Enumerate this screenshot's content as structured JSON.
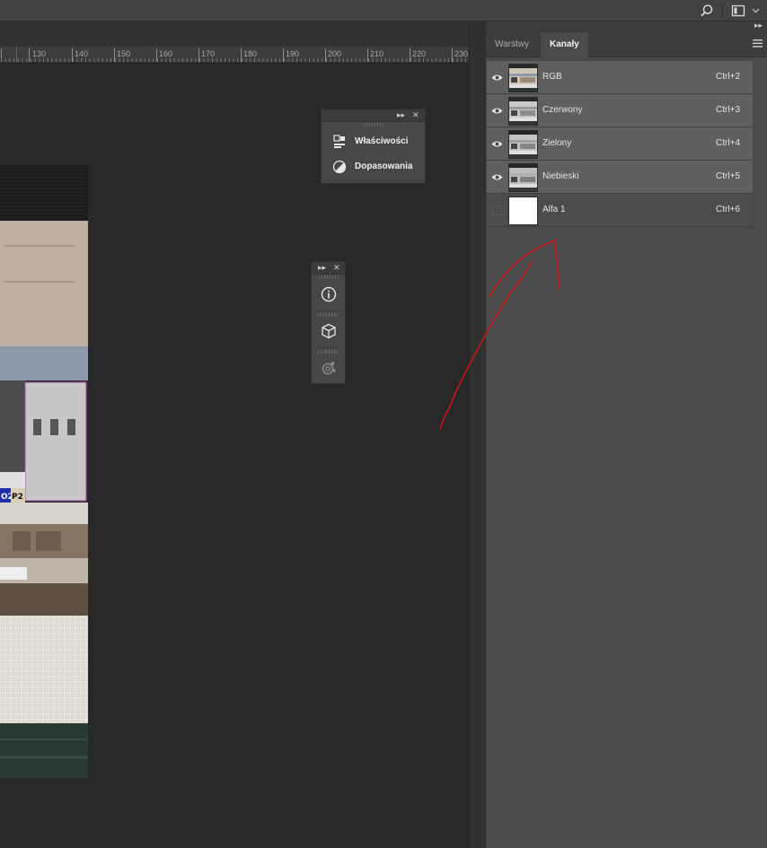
{
  "topbar": {
    "search_icon": "search-icon",
    "workspace_icon": "workspace-icon",
    "workspace_chevron": "chevron-down-icon"
  },
  "ruler": {
    "labels": [
      "130",
      "140",
      "150",
      "160",
      "170",
      "180",
      "190",
      "200",
      "210",
      "220",
      "230"
    ]
  },
  "float_panel_1": {
    "items": [
      {
        "label": "Właściwości",
        "icon": "properties-icon"
      },
      {
        "label": "Dopasowania",
        "icon": "adjustments-icon"
      }
    ]
  },
  "float_panel_2": {
    "items": [
      {
        "icon": "info-icon"
      },
      {
        "icon": "3d-cube-icon"
      },
      {
        "icon": "3d-scene-icon"
      }
    ]
  },
  "panel": {
    "tabs": [
      {
        "label": "Warstwy",
        "active": false
      },
      {
        "label": "Kanały",
        "active": true
      }
    ],
    "channels": [
      {
        "name": "RGB",
        "shortcut": "Ctrl+2",
        "visible": true,
        "selected": true
      },
      {
        "name": "Czerwony",
        "shortcut": "Ctrl+3",
        "visible": true,
        "selected": true
      },
      {
        "name": "Zielony",
        "shortcut": "Ctrl+4",
        "visible": true,
        "selected": true
      },
      {
        "name": "Niebieski",
        "shortcut": "Ctrl+5",
        "visible": true,
        "selected": true
      },
      {
        "name": "Alfa 1",
        "shortcut": "Ctrl+6",
        "visible": false,
        "selected": false
      }
    ]
  },
  "colors": {
    "background": "#282828",
    "panel": "#4a4a4a",
    "selected_row": "#5f5f5f",
    "annotation": "#c8161a"
  }
}
